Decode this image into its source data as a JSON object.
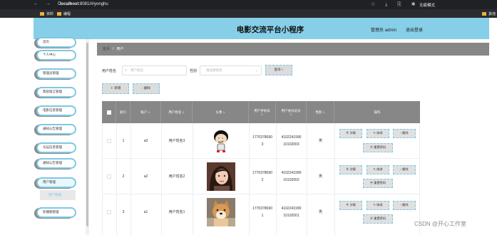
{
  "browser": {
    "nav_glyphs": "← → C ⌂",
    "url_host": "localhost",
    "url_path": ":8081/#/yonghu",
    "right_glyphs": "☆ ⤓ ⎘ ✱",
    "profile": "无痕模式",
    "bookmarks": [
      "资料",
      "编程"
    ],
    "bookmark_right": "其他"
  },
  "header": {
    "title": "电影交流平台小程序",
    "admin": "管理员 admin",
    "logout": "退出登录"
  },
  "sidebar": {
    "items": [
      {
        "label": "首页"
      },
      {
        "label": "个人中心"
      },
      {
        "label": "管理员管理"
      },
      {
        "label": "帮组留言管理"
      },
      {
        "label": "电影信息管理"
      },
      {
        "label": "通知公告管理"
      },
      {
        "label": "论坛信息管理"
      },
      {
        "label": "通知公告管理"
      },
      {
        "label": "用户管理"
      },
      {
        "label": "轮播图管理"
      }
    ],
    "sub_active": "用户管理"
  },
  "breadcrumb": {
    "home": "首页",
    "sep": "/",
    "current": "用户"
  },
  "filters": {
    "name_label": "用户姓名",
    "name_placeholder": "用户姓名",
    "gender_label": "性别",
    "gender_placeholder": "请选择性别",
    "query_button": "查询",
    "add_button": "新增",
    "delete_button": "删除"
  },
  "table": {
    "headers": [
      "索引",
      "账户",
      "用户姓名",
      "头像",
      "用户手机号",
      "用户身份证号",
      "性别",
      "操作"
    ],
    "rows": [
      {
        "index": "1",
        "account": "a3",
        "name": "用户姓名3",
        "phone_a": "1770378690",
        "phone_b": "3",
        "id_a": "4102241990",
        "id_b": "10102003",
        "gender": "男",
        "avatar": "cartoon-boy"
      },
      {
        "index": "2",
        "account": "a2",
        "name": "用户姓名2",
        "phone_a": "1770378690",
        "phone_b": "2",
        "id_a": "4102241990",
        "id_b": "10102002",
        "gender": "男",
        "avatar": "woman-photo"
      },
      {
        "index": "3",
        "account": "a1",
        "name": "用户姓名1",
        "phone_a": "1770378690",
        "phone_b": "1",
        "id_a": "4102241990",
        "id_b": "10102001",
        "gender": "男",
        "avatar": "dog-photo"
      }
    ],
    "ops": {
      "detail": "详情",
      "edit": "修改",
      "delete": "删除",
      "reset": "重置密码"
    }
  },
  "watermark": "CSDN @开心工作室",
  "colors": {
    "accent": "#87cee8",
    "header_gray": "#878787"
  }
}
